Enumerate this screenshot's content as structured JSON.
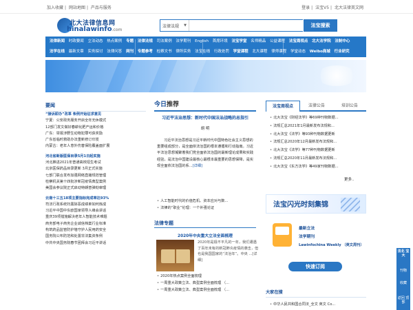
{
  "topbar": {
    "left_links": [
      "加入收藏",
      "网站地图",
      "产品与服务"
    ],
    "right_links": [
      "登录",
      "法宝V5",
      "北大法律英文网"
    ]
  },
  "logo": {
    "title": "北大法律信息网",
    "domain_prefix": "hinalawinfo",
    "domain_suffix": ".com"
  },
  "search": {
    "select_value": "法律法规",
    "placeholder": "",
    "button_label": "法宝搜索"
  },
  "nav": {
    "row1": [
      "法律新闻",
      "时政要闻",
      "立法动态",
      "热点案例",
      "专题",
      "法律法规",
      "司法案例",
      "法学期刊",
      "English",
      "首席环境",
      "法宝学堂",
      "名师精品",
      "公益课程",
      "法宝周视点",
      "北大法学院",
      "法制中心"
    ],
    "row2": [
      "法学在线",
      "最新文章",
      "实务探讨",
      "法律问答",
      "网刊",
      "专题参考",
      "检察文书",
      "律所实务",
      "法宝在线",
      "行政处罚",
      "学堂课程",
      "北大课程",
      "律师课程",
      "学堂动态",
      "Weibo商城",
      "行业研究"
    ]
  },
  "left": {
    "title": "要闻",
    "groups": [
      {
        "highlight": "“接诉即办”改革 条例开始征求意见",
        "items": [
          "宁夏：公安政务服务开启全年无休模式",
          "12部门发文做好春耕化肥产运和价格",
          "广东：举报涉野生动物犯罪可获奖励",
          "广东省临时救助办法重新修订印发",
          "内蒙古：老年人意外伤害保险覆盖面扩展"
        ]
      },
      {
        "highlight": "河北省新版医保目录5月1日起实施",
        "items": [
          "河北推进2021年普通高校招生考试",
          "北京医保药品目录更新 3月正式实施",
          "七部门联合发布加强网络直播规范管理",
          "检察机关第十四批涉新冠疫情典型案例",
          "美国会参议院正式启动特朗普弹劾审理"
        ]
      },
      {
        "highlight": "云南十三五18项主要指标完成率达93%",
        "items": [
          "司法行政系统扫黑除恶成绩单如何炼成",
          "习近平中国中东欧国家领导人峰会讲话",
          "重庆39项措施解决老年人智能技术难题",
          "商务部电子商务企业诚信档案行业标准",
          "构筑药品监管防护墙守护人民用药安全",
          "国务院公布防范和处置非法集资条例",
          "中共中央国务院春节团拜会习近平讲话"
        ]
      }
    ]
  },
  "middle": {
    "today_a": "今日",
    "today_b": "推荐",
    "article_title": "习近平法治思想：新时代中国法治战略的总指引",
    "article_author": "胡 明",
    "article_body": "习近平法治思想是习近平新时代中国特色社会主义思想的重要组成部分，是全面依法治国的根本遵循和行动指南。习近平法治思想凝聚着我们党全面依法治国的最新理论成果和实践经验，是法治中国建设最核心最根本最重要的思想保障，是实现全面依法治国的系...",
    "article_more": "[详细]",
    "list": [
      "人工智能时代的价值危机、资本应对与数...",
      "法律的“职业”伦理：一个补强论证"
    ],
    "topic_title": "法律专题",
    "topic_feature": "2020年中央重大立法全面梳理",
    "topic_text": "2020年是极不平凡的一年，我们遭遇了百年未有的新冠肺炎疫情的袭击，但也是我国国家的“法治年”。中央 ...[详细]",
    "topic_list": [
      "2020年热点案例全面梳理",
      "一周重大政策立法、典型案例全面梳理 （...",
      "一周重大政策立法、典型案例全面梳理 （..."
    ]
  },
  "right": {
    "tabs": [
      "法宝周视点",
      "法律公告",
      "培训公告"
    ],
    "active_tab": "法宝周视点",
    "list": [
      "北大法宝《财经法学》等69种刊物数据...",
      "法规汇总2021年1月最新发布法规和...",
      "北大法宝《法学》等93种刊物数据更新",
      "法规汇总2020年12月最新发布法规和...",
      "北大法宝《法学》等77种刊物数据更新",
      "法规汇总2020年11月最新发布法规和...",
      "北大法宝《东方法学》等49家刊物数据..."
    ],
    "more": "更多..",
    "promo": "法宝闪光时刻集锦",
    "subscribe": [
      "最新立法",
      "法学期刊",
      "Lawinfochina Weekly （英文周刊）"
    ],
    "quick_btn": "快速订阅",
    "online_title": "大家在搜",
    "online_item": "中华人民共和国合同法_全文 英文 Co..."
  },
  "float": {
    "top": "法北 宝大 ",
    "mid1": "刊物",
    "mid2": "收藏",
    "bottom": "返回 顶部"
  }
}
